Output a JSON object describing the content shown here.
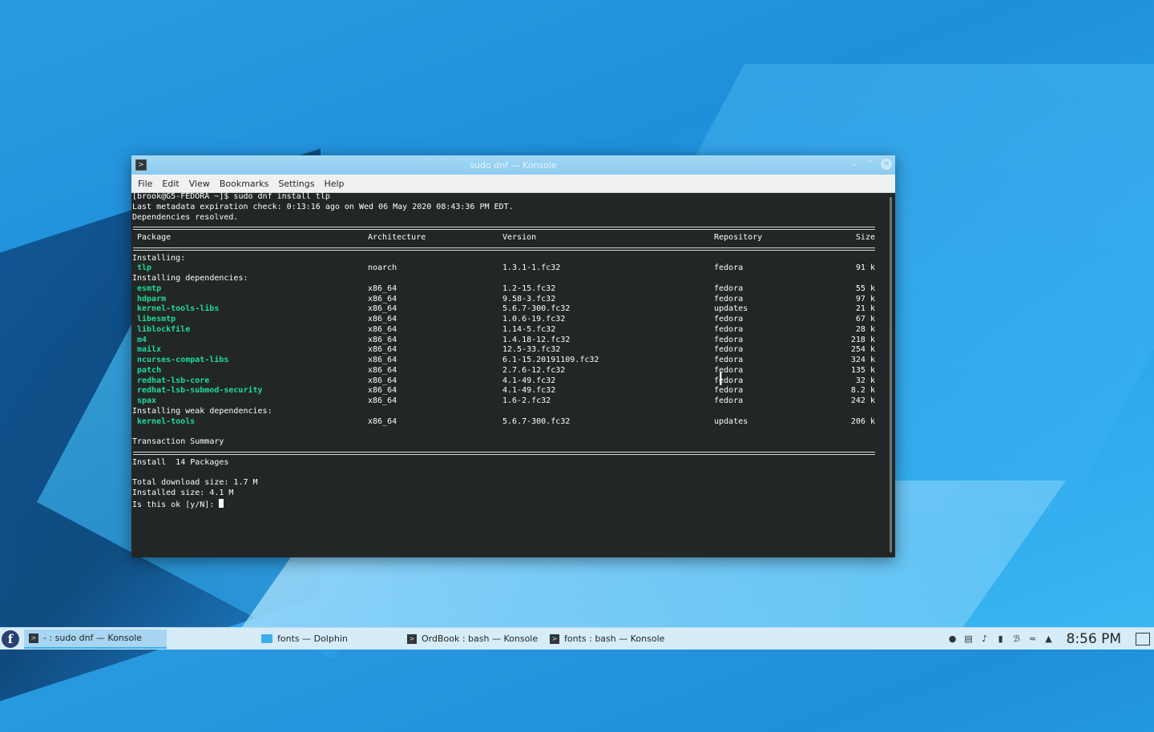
{
  "window": {
    "title": "sudo dnf — Konsole",
    "menu": [
      "File",
      "Edit",
      "View",
      "Bookmarks",
      "Settings",
      "Help"
    ]
  },
  "terminal": {
    "prompt_line": "[brook@G5-FEDORA ~]$ sudo dnf install tlp",
    "metadata_line": "Last metadata expiration check: 0:13:16 ago on Wed 06 May 2020 08:43:36 PM EDT.",
    "deps_resolved": "Dependencies resolved.",
    "headers": {
      "package": "Package",
      "arch": "Architecture",
      "version": "Version",
      "repo": "Repository",
      "size": "Size"
    },
    "section_installing": "Installing:",
    "installing": [
      {
        "name": "tlp",
        "arch": "noarch",
        "version": "1.3.1-1.fc32",
        "repo": "fedora",
        "size": "91 k"
      }
    ],
    "section_deps": "Installing dependencies:",
    "dependencies": [
      {
        "name": "esmtp",
        "arch": "x86_64",
        "version": "1.2-15.fc32",
        "repo": "fedora",
        "size": "55 k"
      },
      {
        "name": "hdparm",
        "arch": "x86_64",
        "version": "9.58-3.fc32",
        "repo": "fedora",
        "size": "97 k"
      },
      {
        "name": "kernel-tools-libs",
        "arch": "x86_64",
        "version": "5.6.7-300.fc32",
        "repo": "updates",
        "size": "21 k"
      },
      {
        "name": "libesmtp",
        "arch": "x86_64",
        "version": "1.0.6-19.fc32",
        "repo": "fedora",
        "size": "67 k"
      },
      {
        "name": "liblockfile",
        "arch": "x86_64",
        "version": "1.14-5.fc32",
        "repo": "fedora",
        "size": "28 k"
      },
      {
        "name": "m4",
        "arch": "x86_64",
        "version": "1.4.18-12.fc32",
        "repo": "fedora",
        "size": "218 k"
      },
      {
        "name": "mailx",
        "arch": "x86_64",
        "version": "12.5-33.fc32",
        "repo": "fedora",
        "size": "254 k"
      },
      {
        "name": "ncurses-compat-libs",
        "arch": "x86_64",
        "version": "6.1-15.20191109.fc32",
        "repo": "fedora",
        "size": "324 k"
      },
      {
        "name": "patch",
        "arch": "x86_64",
        "version": "2.7.6-12.fc32",
        "repo": "fedora",
        "size": "135 k"
      },
      {
        "name": "redhat-lsb-core",
        "arch": "x86_64",
        "version": "4.1-49.fc32",
        "repo": "fedora",
        "size": "32 k"
      },
      {
        "name": "redhat-lsb-submod-security",
        "arch": "x86_64",
        "version": "4.1-49.fc32",
        "repo": "fedora",
        "size": "8.2 k"
      },
      {
        "name": "spax",
        "arch": "x86_64",
        "version": "1.6-2.fc32",
        "repo": "fedora",
        "size": "242 k"
      }
    ],
    "section_weak": "Installing weak dependencies:",
    "weak": [
      {
        "name": "kernel-tools",
        "arch": "x86_64",
        "version": "5.6.7-300.fc32",
        "repo": "updates",
        "size": "206 k"
      }
    ],
    "transaction_summary": "Transaction Summary",
    "install_line": "Install  14 Packages",
    "total_download": "Total download size: 1.7 M",
    "installed_size": "Installed size: 4.1 M",
    "confirm_prompt": "Is this ok [y/N]: "
  },
  "taskbar": {
    "tasks": [
      {
        "label": "- : sudo dnf — Konsole"
      },
      {
        "label": "fonts — Dolphin"
      },
      {
        "label": "OrdBook : bash — Konsole"
      },
      {
        "label": "fonts : bash — Konsole"
      }
    ],
    "clock": "8:56 PM"
  },
  "colors": {
    "package_name": "#1cdc9a",
    "terminal_bg": "#232627",
    "accent": "#3daee9"
  }
}
